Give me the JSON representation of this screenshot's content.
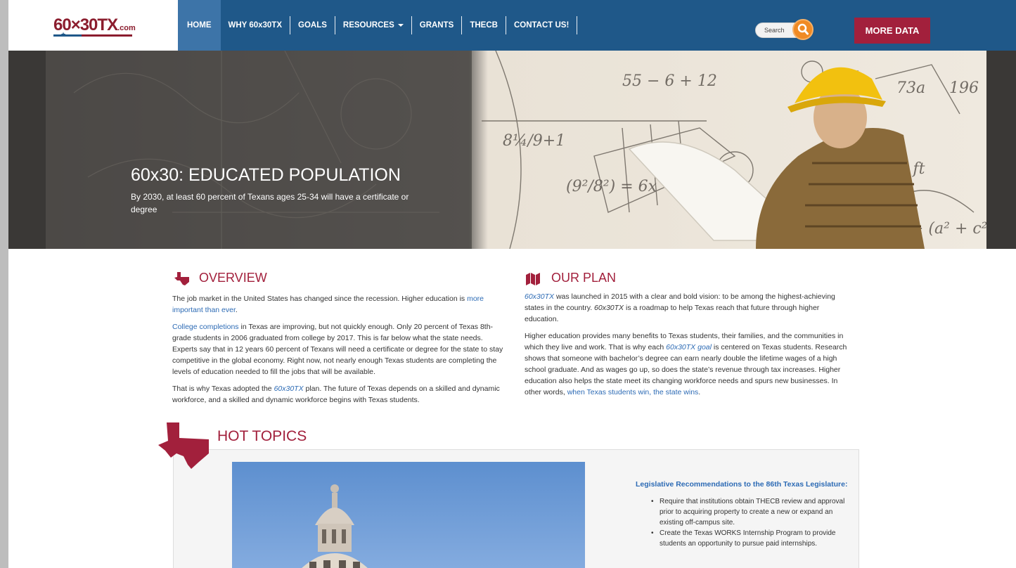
{
  "nav": {
    "logo_main": "60×30TX",
    "logo_suffix": ".com",
    "items": [
      {
        "label": "HOME"
      },
      {
        "label": "WHY 60x30TX"
      },
      {
        "label": "GOALS"
      },
      {
        "label": "RESOURCES"
      },
      {
        "label": "GRANTS"
      },
      {
        "label": "THECB"
      },
      {
        "label": "CONTACT US!"
      }
    ],
    "search_placeholder": "Search",
    "cta": "MORE DATA"
  },
  "hero": {
    "title": "60x30: EDUCATED POPULATION",
    "subtitle": "By 2030, at least 60 percent of Texans ages 25-34 will have a certificate or degree"
  },
  "overview": {
    "title": "OVERVIEW",
    "p1_a": "The job market in the United States has changed since the recession. Higher education is ",
    "p1_link": "more important than ever",
    "p1_b": ".",
    "p2_link": "College completions",
    "p2_b": " in Texas are improving, but not quickly enough. Only 20 percent of Texas 8th-grade students in 2006 graduated from college by 2017. This is far below what the state needs. Experts say that in 12 years 60 percent of Texans will need a certificate or degree for the state to stay competitive in the global economy. Right now, not nearly enough Texas students are completing the levels of education needed to fill the jobs that will be available.",
    "p3_a": "That is why Texas adopted the ",
    "p3_link": "60x30TX",
    "p3_b": " plan. The future of Texas depends on a skilled and dynamic workforce, and a skilled and dynamic workforce begins with Texas students."
  },
  "plan": {
    "title": "OUR PLAN",
    "p1_link": "60x30TX",
    "p1_b": " was launched in 2015 with a clear and bold vision: to be among the highest-achieving states in the country. ",
    "p1_ital": "60x30TX",
    "p1_c": " is a roadmap to help Texas reach that future through higher education.",
    "p2_a": "Higher education provides many benefits to Texas students, their families, and the communities in which they live and work. That is why each ",
    "p2_link": "60x30TX goal",
    "p2_b": " is centered on Texas students. Research shows that someone with bachelor’s degree can earn nearly double the lifetime wages of a high school graduate. And as wages go up, so does the state’s revenue through tax increases. Higher education also helps the state meet its changing workforce needs and spurs new businesses. In other words, ",
    "p2_link2": "when Texas students win, the state wins",
    "p2_c": "."
  },
  "hot": {
    "title": "HOT TOPICS",
    "leg_title": "Legislative Recommendations to the 86th Texas Legislature:",
    "items": [
      "Require that institutions obtain THECB review and approval prior to acquiring property to create a new or expand an existing off-campus site.",
      "Create the Texas WORKS Internship Program to provide students an opportunity to pursue paid internships."
    ]
  },
  "colors": {
    "nav_bg": "#1f5889",
    "accent": "#a2203c",
    "link": "#2d6bb5"
  }
}
